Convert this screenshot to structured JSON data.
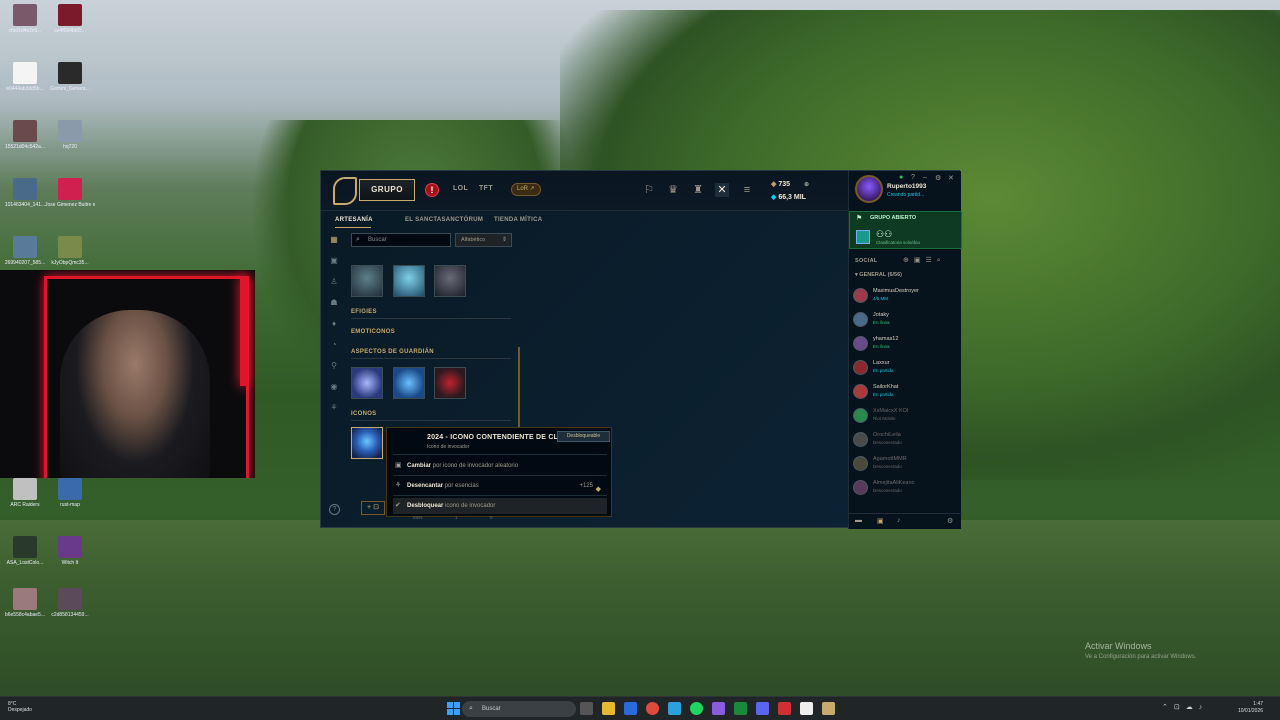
{
  "desktop": {
    "icons": [
      {
        "label": "cfdd1d4e2c0...",
        "color": "#7a5a6a"
      },
      {
        "label": "ce4f0d4bbf3...",
        "color": "#7a1a2a"
      },
      {
        "label": "e0444ab3dd5b...",
        "color": "#f4f4f4"
      },
      {
        "label": "Gemini_Genera...",
        "color": "#2a2a2a"
      },
      {
        "label": "15521d04c542a...",
        "color": "#6a4a4a"
      },
      {
        "label": "hq720",
        "color": "#8a9aaa"
      },
      {
        "label": "101463404_141...",
        "color": "#4a6a8a"
      },
      {
        "label": "Jose Gimenez Buitre en casino",
        "color": "#d02050"
      },
      {
        "label": "269940207_585...",
        "color": "#5a7a9a"
      },
      {
        "label": "kJyObpQmc35...",
        "color": "#7a8a4a"
      },
      {
        "label": "ARC Raiders",
        "color": "#c0c0c0"
      },
      {
        "label": "rust-map",
        "color": "#3a6aaa"
      },
      {
        "label": "ASA_LostColo...",
        "color": "#2a3a2a"
      },
      {
        "label": "Witch It",
        "color": "#6a3a8a"
      },
      {
        "label": "b6e558c4abae5...",
        "color": "#9a7a7a"
      },
      {
        "label": "c2d858134459...",
        "color": "#5a4a5a"
      }
    ]
  },
  "client": {
    "play_label": "GRUPO",
    "nav": [
      "LOL",
      "TFT"
    ],
    "lor_label": "LoR",
    "rp": "735",
    "blue_essence": "66,3 MIL",
    "subnav": [
      "ARTESANÍA",
      "EL SANCTASANCTÓRUM",
      "TIENDA MÍTICA"
    ],
    "search_placeholder": "Buscar",
    "sort_label": "Alfabético",
    "sections": {
      "efigies": "EFIGIES",
      "emoticonos": "EMOTICONOS",
      "aspectos_guardian": "ASPECTOS DE GUARDIÁN",
      "iconos": "ICONOS"
    },
    "popup": {
      "title": "2024 - ICONO CONTENDIENTE DE CLASH",
      "subtitle": "Icono de invocador",
      "badge": "Desbloqueable",
      "options": [
        {
          "action": "Cambiar",
          "desc": "por icono de invocador aleatorio",
          "value": ""
        },
        {
          "action": "Desencantar",
          "desc": "por esencias",
          "value": "+125"
        },
        {
          "action": "Desbloquear",
          "desc": "icono de invocador",
          "value": ""
        }
      ]
    },
    "bottom_counts": [
      "5891",
      "1",
      "0"
    ]
  },
  "social": {
    "username": "Ruperto1993",
    "user_status": "Creando partid...",
    "party_title": "GRUPO ABIERTO",
    "party_status": "Clasificatoria solo/dúo",
    "social_label": "SOCIAL",
    "group_label": "GENERAL (6/56)",
    "friends": [
      {
        "name": "MaximusDestroyer",
        "status": "4/5 MM",
        "state": "game",
        "color": "#9a3a4a"
      },
      {
        "name": "Jotaky",
        "status": "En línea",
        "state": "online",
        "color": "#4a6a8a"
      },
      {
        "name": "yhamas12",
        "status": "En línea",
        "state": "online",
        "color": "#6a4a8a"
      },
      {
        "name": "Laxxur",
        "status": "En partida",
        "state": "game",
        "color": "#8a2a2a"
      },
      {
        "name": "SailorKhat",
        "status": "En partida",
        "state": "game",
        "color": "#aa3a3a"
      },
      {
        "name": "XxMaicxX KOI",
        "status": "Riot Mobile",
        "state": "off",
        "color": "#2a8a4a"
      },
      {
        "name": "OrochiLeila",
        "status": "Desconectado",
        "state": "off",
        "color": "#4a4a4a"
      },
      {
        "name": "AgamottMMR",
        "status": "Desconectado",
        "state": "off",
        "color": "#4a4a3a"
      },
      {
        "name": "AlmejitaAliKeano",
        "status": "Desconectado",
        "state": "off",
        "color": "#5a3a5a"
      }
    ]
  },
  "watermark": {
    "line1": "Activar Windows",
    "line2": "Ve a Configuración para activar Windows."
  },
  "taskbar": {
    "weather_temp": "8°C",
    "weather_desc": "Despejado",
    "search_placeholder": "Buscar",
    "time": "1:47",
    "date": "10/01/2026"
  }
}
